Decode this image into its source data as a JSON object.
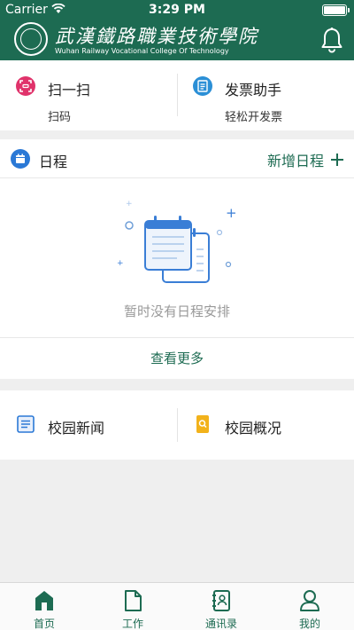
{
  "status_bar": {
    "carrier": "Carrier",
    "time": "3:29 PM"
  },
  "header": {
    "school_name_cn": "武漢鐵路職業技術學院",
    "school_name_en": "Wuhan Railway Vocational College Of Technology"
  },
  "quick_actions": [
    {
      "title": "扫一扫",
      "subtitle": "扫码",
      "icon": "scan-icon",
      "color": "#e0336b"
    },
    {
      "title": "发票助手",
      "subtitle": "轻松开发票",
      "icon": "invoice-icon",
      "color": "#2b8fd6"
    }
  ],
  "schedule": {
    "title": "日程",
    "add_label": "新增日程",
    "empty_text": "暂时没有日程安排",
    "more_label": "查看更多"
  },
  "campus": [
    {
      "title": "校园新闻",
      "icon": "news-icon"
    },
    {
      "title": "校园概况",
      "icon": "overview-icon"
    }
  ],
  "tabs": [
    {
      "label": "首页",
      "icon": "home-icon",
      "active": true
    },
    {
      "label": "工作",
      "icon": "document-icon",
      "active": false
    },
    {
      "label": "通讯录",
      "icon": "contacts-icon",
      "active": false
    },
    {
      "label": "我的",
      "icon": "profile-icon",
      "active": false
    }
  ],
  "colors": {
    "brand": "#1d6b52",
    "accent_blue": "#2b79d6"
  }
}
